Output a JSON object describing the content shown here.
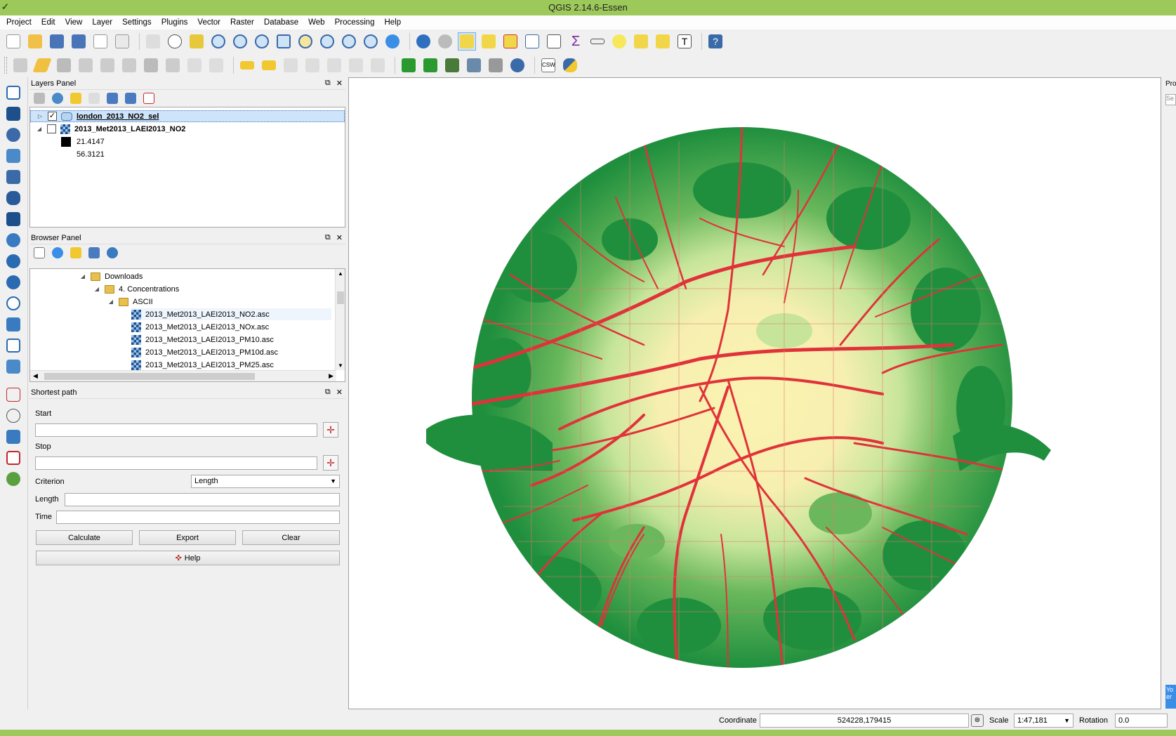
{
  "window": {
    "title": "QGIS 2.14.6-Essen"
  },
  "menu": [
    "Project",
    "Edit",
    "View",
    "Layer",
    "Settings",
    "Plugins",
    "Vector",
    "Raster",
    "Database",
    "Web",
    "Processing",
    "Help"
  ],
  "layers_panel": {
    "title": "Layers Panel",
    "layers": [
      {
        "name": "london_2013_NO2_sel",
        "checked": "✓",
        "expanded": "▷"
      },
      {
        "name": "2013_Met2013_LAEI2013_NO2",
        "checked": "",
        "expanded": "◢"
      }
    ],
    "legend": [
      "21.4147",
      "56.3121"
    ]
  },
  "browser_panel": {
    "title": "Browser Panel",
    "tree": [
      {
        "label": "Downloads",
        "type": "folder"
      },
      {
        "label": "4. Concentrations",
        "type": "folder"
      },
      {
        "label": "ASCII",
        "type": "folder"
      },
      {
        "label": "2013_Met2013_LAEI2013_NO2.asc",
        "type": "raster"
      },
      {
        "label": "2013_Met2013_LAEI2013_NOx.asc",
        "type": "raster"
      },
      {
        "label": "2013_Met2013_LAEI2013_PM10.asc",
        "type": "raster"
      },
      {
        "label": "2013_Met2013_LAEI2013_PM10d.asc",
        "type": "raster"
      },
      {
        "label": "2013_Met2013_LAEI2013_PM25.asc",
        "type": "raster"
      }
    ]
  },
  "shortest_path": {
    "title": "Shortest path",
    "start_label": "Start",
    "stop_label": "Stop",
    "criterion_label": "Criterion",
    "criterion_value": "Length",
    "length_label": "Length",
    "time_label": "Time",
    "calculate": "Calculate",
    "export": "Export",
    "clear": "Clear",
    "help": "Help"
  },
  "right_panel": {
    "title": "Pro",
    "search": "Se",
    "note": "Yo er"
  },
  "status": {
    "coordinate_label": "Coordinate",
    "coordinate_value": "524228,179415",
    "scale_label": "Scale",
    "scale_value": "1:47,181",
    "rotation_label": "Rotation",
    "rotation_value": "0.0"
  },
  "colors": {
    "green_dark": "#1f8f3e",
    "green_mid": "#6bb85c",
    "green_light": "#c6e59a",
    "yellow": "#fbf3b0",
    "red": "#e0323a",
    "titlebar": "#9dc85a"
  }
}
